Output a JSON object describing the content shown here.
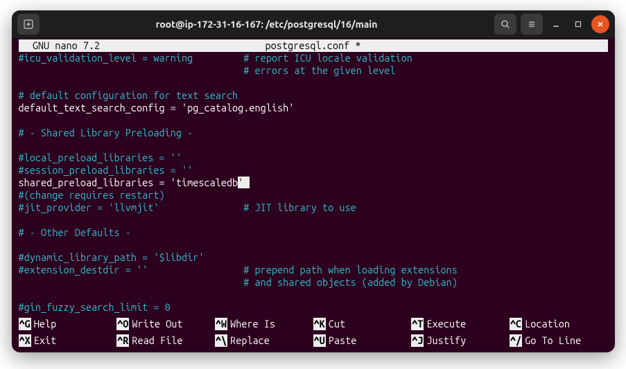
{
  "window": {
    "title": "root@ip-172-31-16-167: /etc/postgresql/16/main"
  },
  "nano": {
    "app": "  GNU nano 7.2",
    "file": "postgresql.conf *"
  },
  "lines": [
    {
      "c": "#icu_validation_level = warning         # report ICU locale validation",
      "t": "comment"
    },
    {
      "c": "                                        # errors at the given level",
      "t": "comment"
    },
    {
      "c": "",
      "t": "blank"
    },
    {
      "c": "# default configuration for text search",
      "t": "comment"
    },
    {
      "c": "default_text_search_config = 'pg_catalog.english'",
      "t": "plain"
    },
    {
      "c": "",
      "t": "blank"
    },
    {
      "c": "# - Shared Library Preloading -",
      "t": "comment"
    },
    {
      "c": "",
      "t": "blank"
    },
    {
      "c": "#local_preload_libraries = ''",
      "t": "comment"
    },
    {
      "c": "#session_preload_libraries = ''",
      "t": "comment"
    },
    {
      "c": "shared_preload_libraries = 'timescaledb'",
      "t": "cursor"
    },
    {
      "c": "#(change requires restart)",
      "t": "comment"
    },
    {
      "c": "#jit_provider = 'llvmjit'               # JIT library to use",
      "t": "comment"
    },
    {
      "c": "",
      "t": "blank"
    },
    {
      "c": "# - Other Defaults -",
      "t": "comment"
    },
    {
      "c": "",
      "t": "blank"
    },
    {
      "c": "#dynamic_library_path = '$libdir'",
      "t": "comment"
    },
    {
      "c": "#extension_destdir = ''                 # prepend path when loading extensions",
      "t": "comment"
    },
    {
      "c": "                                        # and shared objects (added by Debian)",
      "t": "comment"
    },
    {
      "c": "",
      "t": "blank"
    },
    {
      "c": "#gin_fuzzy_search_limit = 0",
      "t": "comment"
    }
  ],
  "shortcuts": {
    "row1": [
      {
        "key": "^G",
        "label": "Help"
      },
      {
        "key": "^O",
        "label": "Write Out"
      },
      {
        "key": "^W",
        "label": "Where Is"
      },
      {
        "key": "^K",
        "label": "Cut"
      },
      {
        "key": "^T",
        "label": "Execute"
      },
      {
        "key": "^C",
        "label": "Location"
      }
    ],
    "row2": [
      {
        "key": "^X",
        "label": "Exit"
      },
      {
        "key": "^R",
        "label": "Read File"
      },
      {
        "key": "^\\",
        "label": "Replace"
      },
      {
        "key": "^U",
        "label": "Paste"
      },
      {
        "key": "^J",
        "label": "Justify"
      },
      {
        "key": "^/",
        "label": "Go To Line"
      }
    ]
  }
}
